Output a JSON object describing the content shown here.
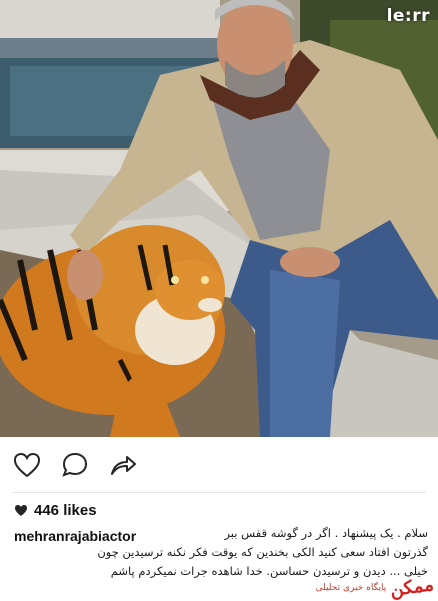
{
  "photo": {
    "watermark": "le:rr",
    "alt": "photo"
  },
  "actions": {
    "like_icon": "heart-outline-icon",
    "comment_icon": "comment-bubble-icon",
    "share_icon": "share-arrow-icon"
  },
  "post": {
    "likes_text": "446 likes",
    "username": "mehranrajabiactor",
    "caption_lines": [
      "سلام . یک پیشنهاد . اگر در گوشه قفس ببر",
      "گذرتون افتاد سعی کنید الکی بخندین که یوقت فکر نکنه ترسیدین چون",
      "خیلی ... دیدن و ترسیدن حساسن. خدا شاهده جرات نمیکردم پاشم"
    ]
  },
  "site_logo": {
    "big": "ممکن",
    "small": "پایگاه خبری تحلیلی"
  },
  "colors": {
    "accent_red": "#d4201f",
    "text": "#111111",
    "divider": "#e6e6e6"
  }
}
